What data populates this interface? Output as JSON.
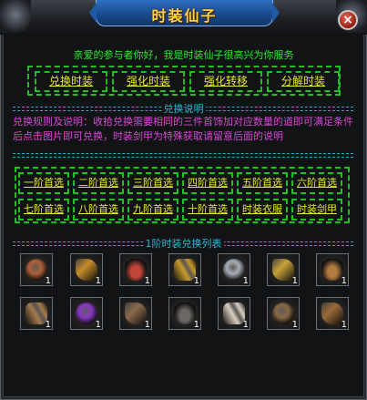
{
  "window": {
    "title": "时装仙子",
    "close_icon": "×"
  },
  "greeting": "亲爱的参与者你好，我是时装仙子很高兴为你服务",
  "services": [
    "兑换时装",
    "强化时装",
    "强化转移",
    "分解时装"
  ],
  "section_rules": {
    "title": "兑换说明",
    "text": "兑换规则及说明：收拾兑换需要相同的三件首饰加对应数量的道即可满足条件后点击图片即可兑换，时装剑甲为特殊获取请留意后面的说明"
  },
  "tiers": [
    "一阶首选",
    "二阶首选",
    "三阶首选",
    "四阶首选",
    "五阶首选",
    "六阶首选",
    "七阶首选",
    "八阶首选",
    "九阶首选",
    "十阶首选",
    "时装衣服",
    "时装剑甲"
  ],
  "section_items": {
    "title": "1阶时装兑换列表"
  },
  "items": [
    {
      "icon": "spiked-helmet-icon",
      "count": "1",
      "color": "#b0603a"
    },
    {
      "icon": "horned-mask-icon",
      "count": "1",
      "color": "#c78b2a"
    },
    {
      "icon": "amulet-icon",
      "count": "1",
      "color": "#c2463a"
    },
    {
      "icon": "gold-bracer-icon",
      "count": "1",
      "color": "#c99a2a"
    },
    {
      "icon": "silver-gauntlet-icon",
      "count": "1",
      "color": "#a8b0b8"
    },
    {
      "icon": "gold-bracelet-icon",
      "count": "1",
      "color": "#c7a23a"
    },
    {
      "icon": "rune-cloth-icon",
      "count": "1",
      "color": "#b07a40"
    },
    {
      "icon": "leather-glove-icon",
      "count": "1",
      "color": "#a57a4a"
    },
    {
      "icon": "purple-pendant-icon",
      "count": "1",
      "color": "#8a3ac7"
    },
    {
      "icon": "brown-bracer-icon",
      "count": "1",
      "color": "#8a6a4a"
    },
    {
      "icon": "dark-amulet-icon",
      "count": "1",
      "color": "#6d6a66"
    },
    {
      "icon": "horn-icon",
      "count": "1",
      "color": "#d8d0c0"
    },
    {
      "icon": "bronze-ring-icon",
      "count": "1",
      "color": "#8a6a44"
    },
    {
      "icon": "boots-icon",
      "count": "1",
      "color": "#9a6a3a"
    }
  ]
}
